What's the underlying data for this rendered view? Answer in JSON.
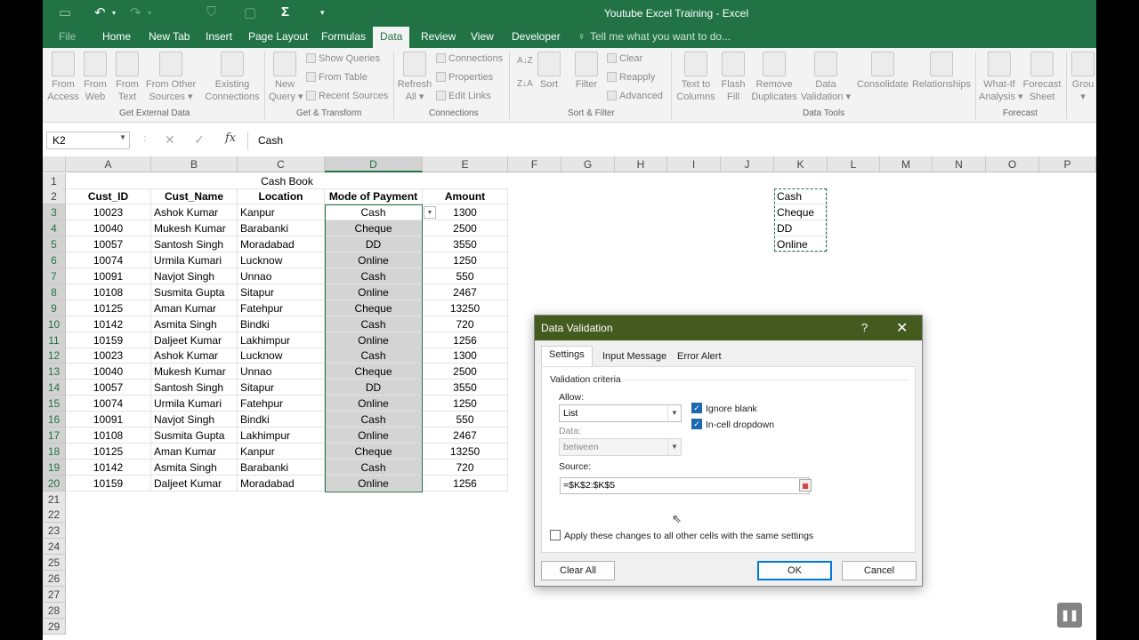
{
  "window": {
    "title": "Youtube Excel Training - Excel"
  },
  "tabs": [
    "File",
    "Home",
    "New Tab",
    "Insert",
    "Page Layout",
    "Formulas",
    "Data",
    "Review",
    "View",
    "Developer"
  ],
  "tell_me": "Tell me what you want to do...",
  "ribbon": {
    "get_external": {
      "label": "Get External Data",
      "buttons": [
        {
          "l1": "From",
          "l2": "Access"
        },
        {
          "l1": "From",
          "l2": "Web"
        },
        {
          "l1": "From",
          "l2": "Text"
        },
        {
          "l1": "From Other",
          "l2": "Sources ▾"
        },
        {
          "l1": "Existing",
          "l2": "Connections"
        }
      ]
    },
    "get_transform": {
      "label": "Get & Transform",
      "new_query": {
        "l1": "New",
        "l2": "Query ▾"
      },
      "small": [
        "Show Queries",
        "From Table",
        "Recent Sources"
      ]
    },
    "connections": {
      "label": "Connections",
      "refresh": {
        "l1": "Refresh",
        "l2": "All ▾"
      },
      "small": [
        "Connections",
        "Properties",
        "Edit Links"
      ]
    },
    "sort_filter": {
      "label": "Sort & Filter",
      "sort": "Sort",
      "filter": "Filter",
      "small": [
        "Clear",
        "Reapply",
        "Advanced"
      ]
    },
    "data_tools": {
      "label": "Data Tools",
      "buttons": [
        {
          "l1": "Text to",
          "l2": "Columns"
        },
        {
          "l1": "Flash",
          "l2": "Fill"
        },
        {
          "l1": "Remove",
          "l2": "Duplicates"
        },
        {
          "l1": "Data",
          "l2": "Validation ▾"
        },
        {
          "l1": "Consolidate",
          "l2": ""
        },
        {
          "l1": "Relationships",
          "l2": ""
        }
      ]
    },
    "forecast": {
      "label": "Forecast",
      "buttons": [
        {
          "l1": "What-If",
          "l2": "Analysis ▾"
        },
        {
          "l1": "Forecast",
          "l2": "Sheet"
        }
      ]
    },
    "outline": {
      "l1": "Grou",
      "l2": "▾"
    }
  },
  "formula_bar": {
    "name_box": "K2",
    "content": "Cash"
  },
  "columns": [
    "A",
    "B",
    "C",
    "D",
    "E",
    "F",
    "G",
    "H",
    "I",
    "J",
    "K",
    "L",
    "M",
    "N",
    "O",
    "P"
  ],
  "rows": [
    "1",
    "2",
    "3",
    "4",
    "5",
    "6",
    "7",
    "8",
    "9",
    "10",
    "11",
    "12",
    "13",
    "14",
    "15",
    "16",
    "17",
    "18",
    "19",
    "20",
    "21",
    "22",
    "23",
    "24",
    "25",
    "26",
    "27",
    "28",
    "29"
  ],
  "sheet": {
    "title": "Cash Book",
    "headers": [
      "Cust_ID",
      "Cust_Name",
      "Location",
      "Mode of Payment",
      "Amount"
    ],
    "records": [
      [
        "10023",
        "Ashok Kumar",
        "Kanpur",
        "Cash",
        "1300"
      ],
      [
        "10040",
        "Mukesh Kumar",
        "Barabanki",
        "Cheque",
        "2500"
      ],
      [
        "10057",
        "Santosh Singh",
        "Moradabad",
        "DD",
        "3550"
      ],
      [
        "10074",
        "Urmila Kumari",
        "Lucknow",
        "Online",
        "1250"
      ],
      [
        "10091",
        "Navjot Singh",
        "Unnao",
        "Cash",
        "550"
      ],
      [
        "10108",
        "Susmita Gupta",
        "Sitapur",
        "Online",
        "2467"
      ],
      [
        "10125",
        "Aman Kumar",
        "Fatehpur",
        "Cheque",
        "13250"
      ],
      [
        "10142",
        "Asmita Singh",
        "Bindki",
        "Cash",
        "720"
      ],
      [
        "10159",
        "Daljeet Kumar",
        "Lakhimpur",
        "Online",
        "1256"
      ],
      [
        "10023",
        "Ashok Kumar",
        "Lucknow",
        "Cash",
        "1300"
      ],
      [
        "10040",
        "Mukesh Kumar",
        "Unnao",
        "Cheque",
        "2500"
      ],
      [
        "10057",
        "Santosh Singh",
        "Sitapur",
        "DD",
        "3550"
      ],
      [
        "10074",
        "Urmila Kumari",
        "Fatehpur",
        "Online",
        "1250"
      ],
      [
        "10091",
        "Navjot Singh",
        "Bindki",
        "Cash",
        "550"
      ],
      [
        "10108",
        "Susmita Gupta",
        "Lakhimpur",
        "Online",
        "2467"
      ],
      [
        "10125",
        "Aman Kumar",
        "Kanpur",
        "Cheque",
        "13250"
      ],
      [
        "10142",
        "Asmita Singh",
        "Barabanki",
        "Cash",
        "720"
      ],
      [
        "10159",
        "Daljeet Kumar",
        "Moradabad",
        "Online",
        "1256"
      ]
    ],
    "payment_list": [
      "Cash",
      "Cheque",
      "DD",
      "Online"
    ]
  },
  "dialog": {
    "title": "Data Validation",
    "help": "?",
    "close": "✕",
    "tabs": [
      "Settings",
      "Input Message",
      "Error Alert"
    ],
    "section": "Validation criteria",
    "allow_label": "Allow:",
    "allow_value": "List",
    "data_label": "Data:",
    "data_value": "between",
    "ignore_blank": "Ignore blank",
    "in_cell_dropdown": "In-cell dropdown",
    "source_label": "Source:",
    "source_value": "=$K$2:$K$5",
    "apply_all": "Apply these changes to all other cells with the same settings",
    "clear_all": "Clear All",
    "ok": "OK",
    "cancel": "Cancel"
  },
  "icons": [
    "save-icon",
    "undo-icon",
    "redo-icon",
    "filter-icon",
    "sum-icon",
    "lightbulb-icon",
    "pause-icon"
  ],
  "colors": {
    "excel_green": "#217346",
    "dialog_title": "#455a1e",
    "selection": "#d4d4d4"
  }
}
